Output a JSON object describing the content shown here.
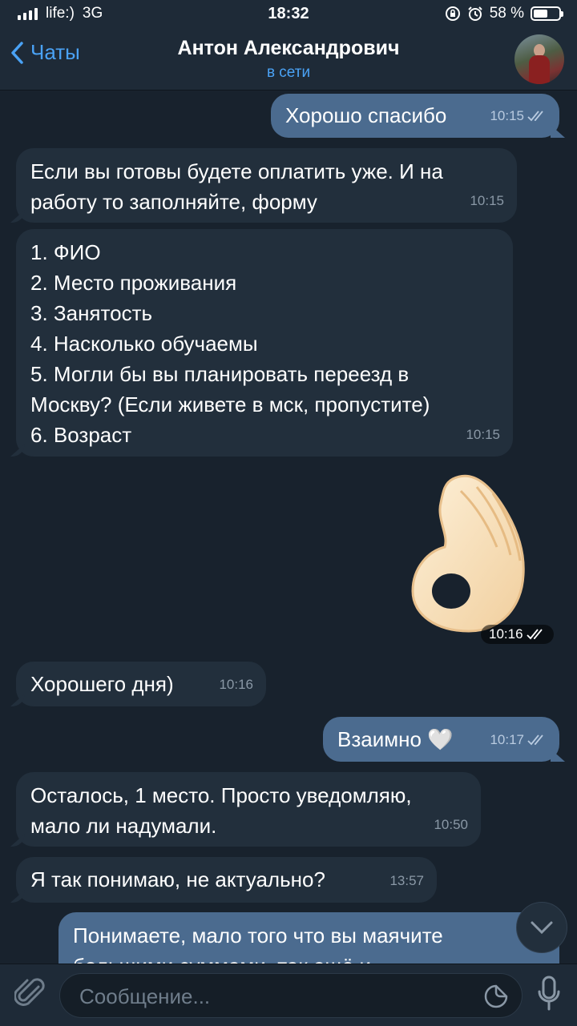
{
  "status_bar": {
    "carrier": "life:)",
    "network": "3G",
    "time": "18:32",
    "battery": "58 %",
    "battery_level": 0.58
  },
  "header": {
    "back_label": "Чаты",
    "title": "Антон Александрович",
    "subtitle": "в сети"
  },
  "messages": [
    {
      "dir": "out",
      "text": "Хорошо спасибо",
      "time": "10:15"
    },
    {
      "dir": "in",
      "text": "Если вы готовы будете оплатить уже. И на\nработу то заполняйте, форму",
      "time": "10:15"
    },
    {
      "dir": "in",
      "text": "1. ФИО\n2. Место проживания\n3. Занятость\n4. Насколько обучаемы\n5. Могли бы вы планировать переезд в\nМоскву? (Если живете в мск, пропустите)\n6. Возраст",
      "time": "10:15"
    },
    {
      "dir": "out",
      "type": "sticker",
      "emoji": "ok-hand",
      "time": "10:16"
    },
    {
      "dir": "in",
      "text": "Хорошего дня)",
      "time": "10:16"
    },
    {
      "dir": "out",
      "text": "Взаимно 🤍",
      "time": "10:17"
    },
    {
      "dir": "in",
      "text": "Осталось, 1 место. Просто уведомляю,\nмало ли надумали.",
      "time": "10:50"
    },
    {
      "dir": "in",
      "text": "Я так понимаю, не актуально?",
      "time": "13:57"
    },
    {
      "dir": "out",
      "text": "Понимаете, мало того что вы маячите\nбольшими суммами, так ещё и",
      "time": ""
    }
  ],
  "input": {
    "placeholder": "Сообщение..."
  },
  "colors": {
    "accent": "#4aa2f5",
    "bubble_in": "#222f3c",
    "bubble_out": "#4b6b8f",
    "background": "#18222d"
  }
}
